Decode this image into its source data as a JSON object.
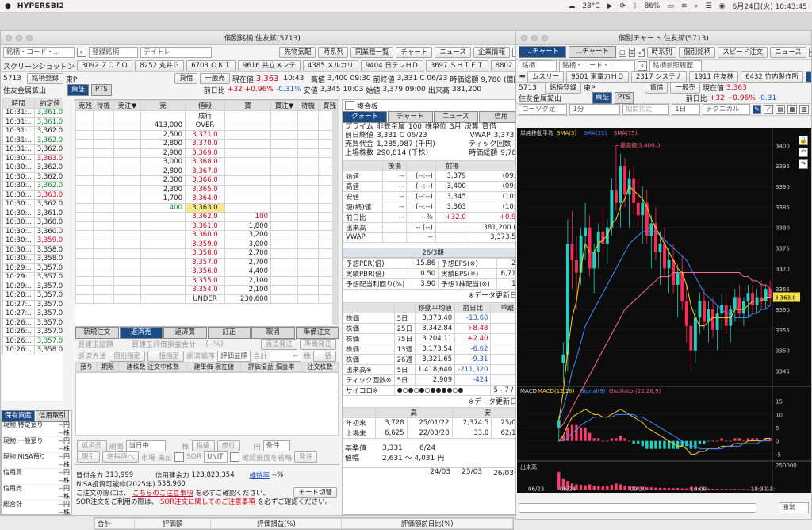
{
  "menubar": {
    "app": "HYPERSBI2",
    "temp": "28°C",
    "battery": "86%",
    "date": "6月24日(火) 10:43:45"
  },
  "left_win": {
    "title": "個別銘柄 住友鉱(5713)",
    "search_placeholder": "銘柄・コード・...",
    "register_btn": "登録銘柄",
    "mode": "デイトレ",
    "toolbar": [
      "先物気配",
      "時系列",
      "同業種一覧",
      "チャート",
      "ニュース",
      "企業情報"
    ],
    "screenshot_label": "スクリーンショット",
    "screenshot_tabs": [
      "3092 ＺＯＺＯ",
      "8252 丸井Ｇ",
      "6703 ＯＫＩ",
      "9616 共立メンテ",
      "4385 メルカリ",
      "9404 日テレＨＤ",
      "3697 ＳＨＩＦＴ",
      "8802 三菱地所"
    ],
    "stock": {
      "code": "5713",
      "register": "銘柄登録",
      "market": "東P",
      "name": "住友金属鉱山",
      "badge1": "東証",
      "badge2": "PTS"
    },
    "buttons": {
      "lend": "貸借",
      "general": "一般売"
    },
    "quote": {
      "price_label": "現在値",
      "price": "3,363",
      "time": "10:43",
      "high_label": "高値",
      "high": "3,400 09:30",
      "prev_label": "前終値",
      "prev": "3,331 C 06/23",
      "cap_label": "時価総額",
      "cap": "9,780 (億円)",
      "chg_label": "前日比",
      "chg": "+32",
      "chgpct": "+0.96%",
      "chgpct2": "-0.31%",
      "low_label": "安値",
      "low": "3,345 10:03",
      "open_label": "始値",
      "open": "3,379 09:00",
      "vol_label": "出来高",
      "vol": "381,200",
      "val_label": "売買代金",
      "val": "1,285,987 (千"
    },
    "ticks": {
      "headers": [
        "時間",
        "約定値"
      ],
      "rows": [
        [
          "10:31:..",
          "3,361.0",
          "g"
        ],
        [
          "10:31:..",
          "3,361.0",
          "g"
        ],
        [
          "10:31:..",
          "3,362.0",
          "k"
        ],
        [
          "10:31:..",
          "3,362.0",
          "g"
        ],
        [
          "10:31:..",
          "3,362.0",
          "k"
        ],
        [
          "10:30:..",
          "3,363.0",
          "r"
        ],
        [
          "10:30:..",
          "3,362.0",
          "k"
        ],
        [
          "10:30:..",
          "3,362.0",
          "k"
        ],
        [
          "10:30:..",
          "3,362.0",
          "g"
        ],
        [
          "10:30:..",
          "3,363.0",
          "r"
        ],
        [
          "10:30:..",
          "3,362.0",
          "k"
        ],
        [
          "10:30:..",
          "3,361.0",
          "k"
        ],
        [
          "10:30:..",
          "3,360.0",
          "k"
        ],
        [
          "10:30:..",
          "3,360.0",
          "k"
        ],
        [
          "10:30:..",
          "3,359.0",
          "r"
        ],
        [
          "10:30:..",
          "3,358.0",
          "k"
        ],
        [
          "10:30:..",
          "3,358.0",
          "k"
        ],
        [
          "10:29:..",
          "3,357.0",
          "k"
        ],
        [
          "10:29:..",
          "3,357.0",
          "k"
        ],
        [
          "10:29:..",
          "3,357.0",
          "k"
        ],
        [
          "10:28:..",
          "3,357.0",
          "k"
        ],
        [
          "10:27:..",
          "3,357.0",
          "k"
        ],
        [
          "10:27:..",
          "3,357.0",
          "k"
        ],
        [
          "10:26:..",
          "3,357.0",
          "k"
        ],
        [
          "10:26:..",
          "3,357.0",
          "k"
        ],
        [
          "10:26:..",
          "3,357.0",
          "g"
        ],
        [
          "10:26:..",
          "3,358.0",
          "k"
        ]
      ]
    },
    "board": {
      "headers": [
        "売残",
        "待機",
        "売注▼",
        "売",
        "値段",
        "買",
        "買注▼",
        "待機",
        "買残"
      ],
      "rows": [
        [
          "",
          "",
          "成行",
          "",
          ""
        ],
        [
          "",
          "413,000",
          "OVER",
          "",
          ""
        ],
        [
          "",
          "2,500",
          "3,371.0",
          "",
          ""
        ],
        [
          "",
          "2,800",
          "3,370.0",
          "",
          ""
        ],
        [
          "",
          "2,900",
          "3,369.0",
          "",
          ""
        ],
        [
          "",
          "3,000",
          "3,368.0",
          "",
          ""
        ],
        [
          "",
          "2,800",
          "3,367.0",
          "",
          ""
        ],
        [
          "",
          "2,300",
          "3,366.0",
          "",
          ""
        ],
        [
          "",
          "2,300",
          "3,365.0",
          "",
          ""
        ],
        [
          "",
          "1,700",
          "3,364.0",
          "",
          ""
        ],
        [
          "",
          "400",
          "3,363.0",
          "",
          ""
        ],
        [
          "",
          "",
          "3,362.0",
          "100",
          ""
        ],
        [
          "",
          "",
          "3,361.0",
          "1,800",
          ""
        ],
        [
          "",
          "",
          "3,360.0",
          "3,200",
          ""
        ],
        [
          "",
          "",
          "3,359.0",
          "3,000",
          ""
        ],
        [
          "",
          "",
          "3,358.0",
          "2,700",
          ""
        ],
        [
          "",
          "",
          "3,357.0",
          "2,700",
          ""
        ],
        [
          "",
          "",
          "3,356.0",
          "4,400",
          ""
        ],
        [
          "",
          "",
          "3,355.0",
          "2,100",
          ""
        ],
        [
          "",
          "",
          "3,354.0",
          "2,100",
          ""
        ],
        [
          "",
          "",
          "UNDER",
          "230,600",
          ""
        ]
      ]
    },
    "order_tabs": [
      "新規注文",
      "返済売",
      "返済買",
      "訂正",
      "取消",
      "準備注文"
    ],
    "order": {
      "l1": "買建玉総額",
      "l2": "買建玉評価損益合計",
      "v2": "-- (--%)",
      "btn1": "直接発注",
      "btn2": "準備発注",
      "l3": "返済方法",
      "v3": "個別指定",
      "v3b": "一括指定",
      "l4": "返済順序",
      "v4": "評価益順",
      "l5": "合計",
      "v5": "--",
      "u5": "株",
      "btn3": "一括",
      "cols": [
        "預り",
        "期限",
        "建株数 注文中株数",
        "建単価 現在値",
        "評価損益 損益率",
        "注文株数"
      ]
    },
    "order2": {
      "b1": "返済売",
      "b2": "現引",
      "l1": "期間",
      "v1": "当日中",
      "l2": "株",
      "v2": "指値",
      "v3": "成行",
      "l3": "市場",
      "v4": "東証",
      "v5": "SOR",
      "v6": "UNIT",
      "l4": "円",
      "l5": "条件",
      "l6": "確認画面を省略",
      "l7": "発注",
      "btn4": "逆指値へ"
    },
    "holdings": {
      "tab1": "保有資産",
      "tab2": "信用取引",
      "rows": [
        [
          "現物 特定預り",
          "--円",
          "--株"
        ],
        [
          "現物 一般預り",
          "--円",
          "--株"
        ],
        [
          "現物 NISA預り",
          "--円",
          "--株"
        ],
        [
          "信用買",
          "--円",
          "--株"
        ],
        [
          "信用売",
          "--円",
          "--株"
        ],
        [
          "総合計",
          "--円",
          "--株"
        ]
      ]
    },
    "bottom": {
      "buy_power_label": "買付余力",
      "buy_power": "313,999",
      "credit_label": "信用建余力",
      "credit": "123,823,354",
      "margin_label": "維持率",
      "margin": "--%",
      "nisa": "NISA投資可能枠(2025年)",
      "nisa_val": "538,960",
      "notice1": "ご注文の際には、",
      "notice1_link": "こちらのご注意事項",
      "notice1_end": "を必ずご確認ください。",
      "notice2": "SOR注文をご利用の際は、",
      "notice2_link": "SOR注文に関してのご注意事項",
      "notice2_end": "を必ずご確認ください。",
      "mode_btn": "モード切替"
    },
    "footer": {
      "total": "合計",
      "c1": "評価額",
      "c2": "評価損益(%)",
      "c3": "評価額前日比(%)"
    }
  },
  "mid": {
    "composite": "複合板",
    "tabs": [
      "クォート",
      "チャート",
      "ニュース",
      "信用"
    ],
    "info": [
      [
        "プライム",
        "非鉄金属",
        "100",
        "株単位",
        "3月",
        "決算",
        "貸借"
      ],
      [
        "前日終値",
        "3,331 C 06/23",
        "VWAP",
        "3,373.5"
      ],
      [
        "売買代金",
        "1,285,987 (千円)",
        "ティック回数",
        "1,"
      ],
      [
        "上場株数",
        "290,814 (千株)",
        "時価総額",
        "9,780"
      ]
    ],
    "session_heads": [
      "",
      "後場",
      "",
      "前場",
      ""
    ],
    "session": [
      [
        "始値",
        "--",
        "(--:--)",
        "3,379",
        "(09:0"
      ],
      [
        "高値",
        "--",
        "(--:--)",
        "3,400",
        "(09:3"
      ],
      [
        "安値",
        "--",
        "(--:--)",
        "3,345",
        "(10:0"
      ],
      [
        "現(終)値",
        "--",
        "(--:--)",
        "3,363",
        "(10:4"
      ],
      [
        "前日比",
        "--",
        "--%",
        "+32.0",
        "+0.96"
      ],
      [
        "出来高",
        "",
        "-- (--)",
        "",
        "381,200 (1"
      ],
      [
        "VWAP",
        "",
        "--",
        "",
        "3,373.52"
      ]
    ],
    "fy": "26/3期",
    "fund": [
      [
        "予想PER(倍)",
        "15.86",
        "予想EPS(※)",
        "21"
      ],
      [
        "実績PBR(倍)",
        "0.50",
        "実績BPS(※)",
        "6,711"
      ],
      [
        "予想配当利回り(%)",
        "3.90",
        "予想1株配当(※)",
        "13"
      ]
    ],
    "note1": "※データ更新日",
    "ma_heads": [
      "",
      "",
      "移動平均値",
      "前日比",
      "乖離率(%"
    ],
    "ma": [
      [
        "株価",
        "5日",
        "3,373.40",
        "-13.60",
        "-0.31"
      ],
      [
        "株価",
        "25日",
        "3,342.84",
        "+8.48",
        "+0.60"
      ],
      [
        "株価",
        "75日",
        "3,204.11",
        "+2.40",
        "+4.96"
      ],
      [
        "株価",
        "13週",
        "3,173.54",
        "-6.62",
        "+5.97"
      ],
      [
        "株価",
        "26週",
        "3,321.65",
        "-9.31",
        "+1.24"
      ],
      [
        "出来高※",
        "5日",
        "1,418,640",
        "-211,320",
        "-12.96"
      ],
      [
        "ティック回数※",
        "5日",
        "2,909",
        "-424",
        "-12.73"
      ]
    ],
    "psych": [
      "サイコロ※",
      "●○●○●○●●●●○●",
      "5 - 7 / 41.7%"
    ],
    "note2": "※データ更新日",
    "range": {
      "h_head": "高",
      "l_head": "安",
      "r1": [
        "年初来",
        "3,728",
        "25/01/22",
        "2,374.5",
        "25/04"
      ],
      "r2": [
        "上場来",
        "6,625",
        "22/03/28",
        "33.0",
        "62/10"
      ]
    },
    "base": {
      "l1": "基準値",
      "v1": "3,331",
      "d1": "6/24",
      "l2": "値幅",
      "v2": "2,631 ～ 4,031 円"
    },
    "dates": [
      "24/03",
      "25/03",
      "26/03予"
    ]
  },
  "right_win": {
    "title": "個別チャート 住友鉱(5713)",
    "tabs": [
      "...チャート",
      "...チャート"
    ],
    "toolbar": [
      "時系列",
      "個別銘柄",
      "スピード注文",
      "ニュース"
    ],
    "search_label": "銘柄",
    "search_placeholder": "銘柄・コード・...",
    "history": "銘柄参照履歴",
    "stabs": [
      "ムスリー",
      "9501 東電力ＨＤ",
      "2317 システナ",
      "1911 住友林",
      "6432 竹内製作所",
      "57"
    ],
    "stock": {
      "code": "5713",
      "register": "銘柄登録",
      "market": "東P",
      "name": "住友金属鉱山",
      "badge1": "東証",
      "badge2": "PTS"
    },
    "buttons": {
      "lend": "貸借",
      "general": "一般売"
    },
    "quote": {
      "price_label": "現在値",
      "price": "3,363",
      "chg_label": "前日比",
      "chg": "+32",
      "chgpct": "+0.96%",
      "chgpct2": "-0.31"
    },
    "ctrl": {
      "type": "ローソク足",
      "interval": "1分",
      "period": "期間指定",
      "span": "1日",
      "tech": "テクニカル"
    }
  },
  "chart_data": {
    "type": "candlestick",
    "main_title": "単純移動平均",
    "ma_legend": [
      {
        "name": "SMA(5)",
        "color": "#ffd21f"
      },
      {
        "name": "SMA(25)",
        "color": "#3a8cff"
      },
      {
        "name": "SMA(75)",
        "color": "#ff6b8a"
      }
    ],
    "y_ticks": [
      "3400",
      "3395",
      "3390",
      "3385",
      "3380",
      "3375",
      "3370",
      "3365",
      "3360",
      "3355",
      "3350",
      "3345"
    ],
    "ylim": [
      3342,
      3402
    ],
    "max_label": "最高値:3,400.0",
    "last_price": "3,363.0",
    "x_ticks": [
      "06/23",
      "06/24",
      "09:30",
      "10:00",
      "10:30",
      "11:"
    ],
    "candles": [
      [
        3331,
        3334,
        3328,
        3333
      ],
      [
        3347,
        3352,
        3342,
        3349
      ],
      [
        3349,
        3382,
        3345,
        3376
      ],
      [
        3376,
        3384,
        3365,
        3372
      ],
      [
        3372,
        3378,
        3360,
        3369
      ],
      [
        3369,
        3380,
        3366,
        3378
      ],
      [
        3378,
        3386,
        3372,
        3380
      ],
      [
        3380,
        3383,
        3368,
        3370
      ],
      [
        3370,
        3376,
        3364,
        3374
      ],
      [
        3374,
        3381,
        3370,
        3379
      ],
      [
        3379,
        3385,
        3373,
        3376
      ],
      [
        3376,
        3382,
        3371,
        3380
      ],
      [
        3380,
        3392,
        3378,
        3389
      ],
      [
        3389,
        3400,
        3384,
        3386
      ],
      [
        3386,
        3398,
        3380,
        3395
      ],
      [
        3395,
        3397,
        3385,
        3388
      ],
      [
        3388,
        3394,
        3380,
        3392
      ],
      [
        3392,
        3395,
        3383,
        3386
      ],
      [
        3386,
        3392,
        3380,
        3383
      ],
      [
        3383,
        3390,
        3376,
        3386
      ],
      [
        3386,
        3389,
        3376,
        3378
      ],
      [
        3378,
        3383,
        3370,
        3381
      ],
      [
        3381,
        3385,
        3372,
        3374
      ],
      [
        3374,
        3379,
        3366,
        3376
      ],
      [
        3376,
        3380,
        3368,
        3370
      ],
      [
        3370,
        3375,
        3364,
        3372
      ],
      [
        3372,
        3376,
        3364,
        3366
      ],
      [
        3366,
        3371,
        3358,
        3369
      ],
      [
        3369,
        3373,
        3360,
        3362
      ],
      [
        3362,
        3366,
        3352,
        3356
      ],
      [
        3356,
        3360,
        3345,
        3350
      ],
      [
        3350,
        3360,
        3347,
        3358
      ],
      [
        3358,
        3364,
        3354,
        3362
      ],
      [
        3362,
        3365,
        3355,
        3357
      ],
      [
        3357,
        3362,
        3352,
        3360
      ],
      [
        3360,
        3363,
        3353,
        3355
      ],
      [
        3355,
        3361,
        3350,
        3359
      ],
      [
        3359,
        3364,
        3355,
        3361
      ],
      [
        3361,
        3364,
        3354,
        3356
      ],
      [
        3356,
        3361,
        3352,
        3360
      ],
      [
        3360,
        3365,
        3357,
        3363
      ],
      [
        3363,
        3366,
        3358,
        3359
      ],
      [
        3359,
        3363,
        3356,
        3362
      ],
      [
        3362,
        3366,
        3358,
        3364
      ],
      [
        3364,
        3366,
        3359,
        3361
      ],
      [
        3361,
        3365,
        3359,
        3363
      ],
      [
        3363,
        3367,
        3360,
        3362
      ],
      [
        3362,
        3366,
        3360,
        3365
      ],
      [
        3365,
        3367,
        3361,
        3363
      ]
    ],
    "sma5": [
      3333,
      3340,
      3350,
      3358,
      3362,
      3370,
      3376,
      3374,
      3374,
      3376,
      3377,
      3378,
      3381,
      3382,
      3385,
      3387,
      3390,
      3389,
      3388,
      3387,
      3385,
      3382,
      3380,
      3378,
      3376,
      3374,
      3372,
      3370,
      3369,
      3366,
      3361,
      3358,
      3356,
      3356,
      3357,
      3358,
      3358,
      3358,
      3358,
      3358,
      3360,
      3360,
      3360,
      3361,
      3362,
      3362,
      3362,
      3363,
      3363
    ],
    "sma25": [
      3333,
      3336,
      3340,
      3345,
      3348,
      3352,
      3356,
      3358,
      3360,
      3362,
      3364,
      3366,
      3368,
      3370,
      3372,
      3374,
      3376,
      3377,
      3378,
      3379,
      3379,
      3379,
      3379,
      3378,
      3377,
      3376,
      3375,
      3374,
      3373,
      3372,
      3370,
      3368,
      3366,
      3364,
      3363,
      3362,
      3361,
      3360,
      3359,
      3359,
      3358,
      3358,
      3358,
      3358,
      3359,
      3359,
      3360,
      3360,
      3361
    ],
    "sma75": [
      3331,
      3332,
      3334,
      3336,
      3338,
      3340,
      3342,
      3344,
      3346,
      3348,
      3350,
      3352,
      3354,
      3356,
      3358,
      3360,
      3361,
      3362,
      3363,
      3364,
      3365,
      3366,
      3367,
      3368,
      3368,
      3368,
      3369,
      3369,
      3369,
      3369,
      3369,
      3369,
      3369,
      3369,
      3369,
      3369,
      3369,
      3369,
      3369,
      3369,
      3369,
      3369,
      3368,
      3368,
      3367,
      3367,
      3366,
      3366,
      3365
    ],
    "macd_legend": [
      "MACD",
      "MACD(12,26)",
      "Signal(9)",
      "Oscillator(12,26,9)"
    ],
    "macd_y": [
      "15",
      "10",
      "5",
      "0",
      "-5"
    ],
    "macd_ylim": [
      -7,
      17
    ],
    "macd": [
      0,
      2,
      6,
      9,
      10,
      11,
      12,
      11,
      10,
      10,
      9,
      9,
      10,
      11,
      12,
      11,
      10,
      9,
      8,
      7,
      5,
      4,
      3,
      2,
      1,
      0,
      -1,
      -2,
      -2,
      -3,
      -5,
      -5,
      -4,
      -4,
      -3,
      -3,
      -3,
      -2,
      -2,
      -2,
      -1,
      -1,
      -1,
      0,
      0,
      0,
      0,
      1,
      1
    ],
    "signal": [
      0,
      0,
      1,
      3,
      4,
      6,
      7,
      8,
      9,
      9,
      9,
      9,
      9,
      10,
      10,
      10,
      10,
      10,
      9,
      9,
      8,
      7,
      6,
      5,
      4,
      3,
      2,
      1,
      0,
      -1,
      -2,
      -2,
      -3,
      -3,
      -3,
      -3,
      -3,
      -3,
      -2,
      -2,
      -2,
      -2,
      -1,
      -1,
      -1,
      -1,
      0,
      0,
      0
    ],
    "vol_title": "出来高",
    "vol_max_label": "250000",
    "volumes": [
      200,
      120,
      100,
      70,
      60,
      55,
      50,
      60,
      45,
      40,
      35,
      42,
      55,
      70,
      60,
      45,
      40,
      35,
      30,
      28,
      26,
      24,
      22,
      20,
      18,
      16,
      15,
      18,
      14,
      12,
      25,
      20,
      14,
      12,
      11,
      10,
      9,
      8,
      8,
      7,
      7,
      6,
      7,
      6,
      6,
      5,
      6,
      5,
      7
    ],
    "zoom": "通常"
  }
}
